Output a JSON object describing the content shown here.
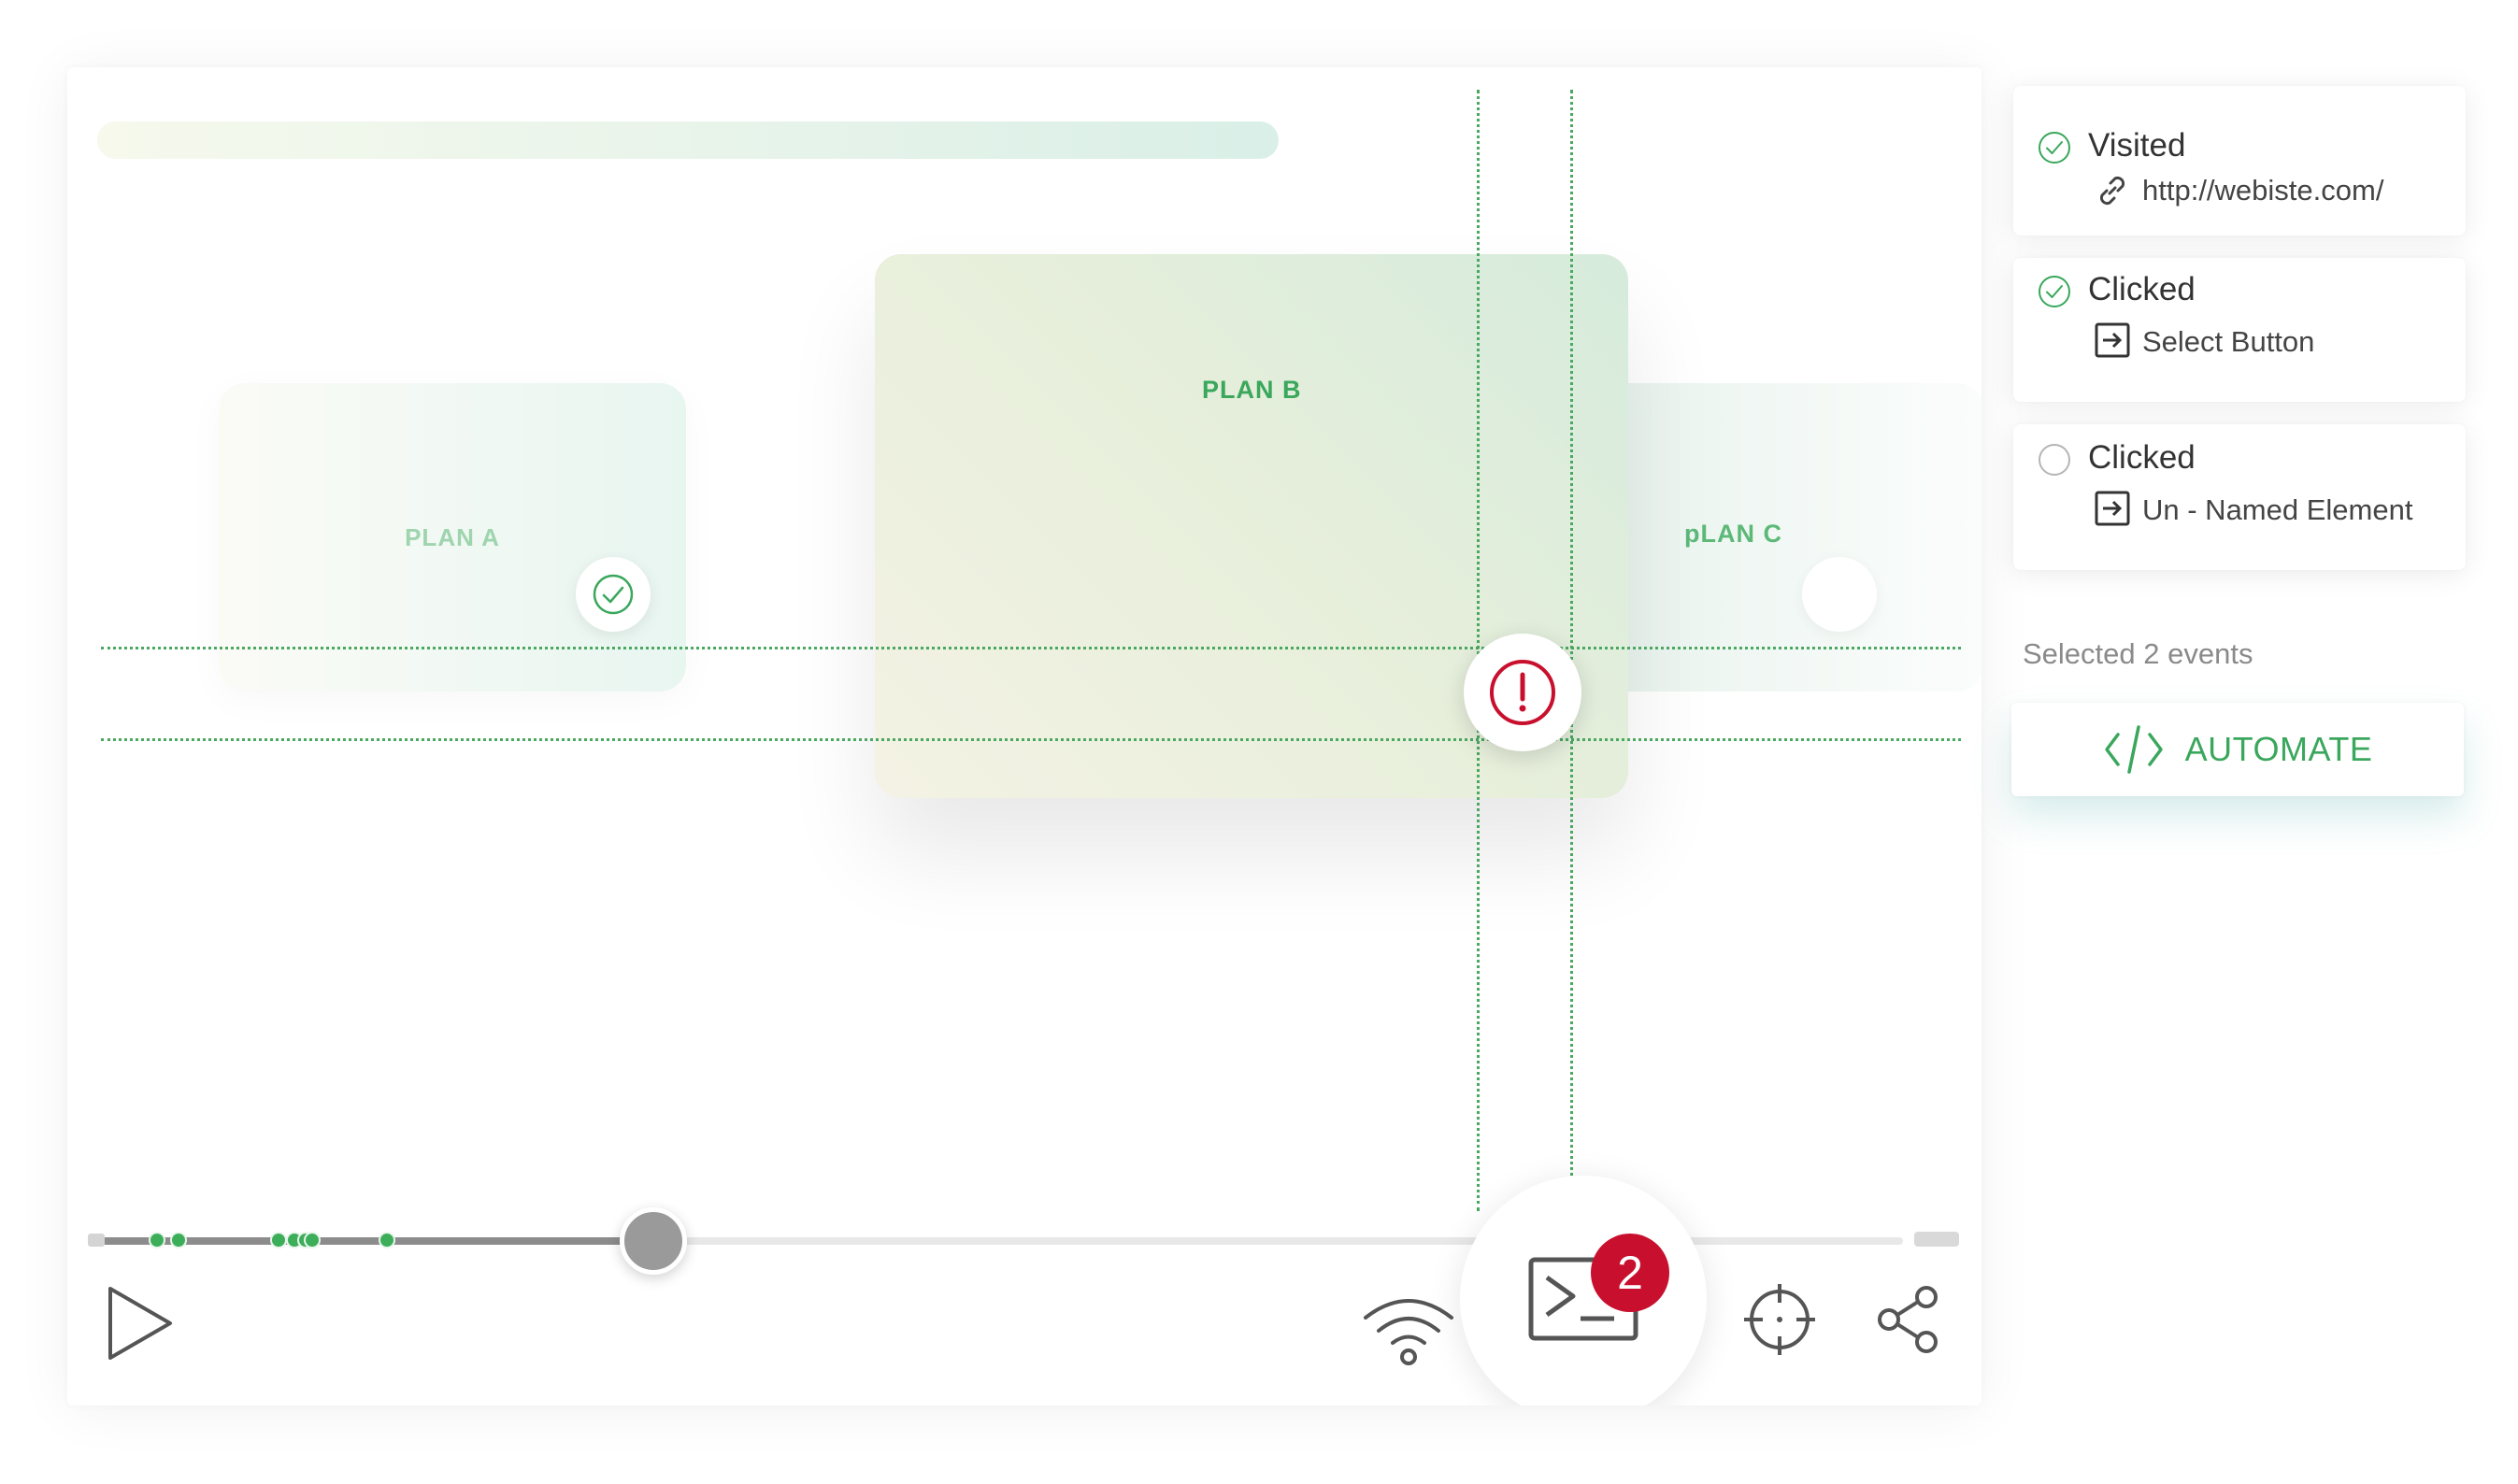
{
  "colors": {
    "accent_green": "#3aa75c",
    "alert_red": "#c8102e",
    "track_fill": "#8c8c8c",
    "marker_green": "#3cae5a"
  },
  "plans": {
    "plan_a": "PLAN A",
    "plan_b": "PLAN B",
    "plan_c": "pLAN C"
  },
  "timeline": {
    "progress": 0.31,
    "event_markers": [
      0.036,
      0.048,
      0.103,
      0.112,
      0.118,
      0.122,
      0.163
    ]
  },
  "controls": {
    "play_icon": "play-icon",
    "wifi_icon": "wifi-icon",
    "terminal_icon": "terminal-icon",
    "target_icon": "crosshair-icon",
    "share_icon": "share-icon",
    "terminal_badge_count": "2"
  },
  "events": [
    {
      "status": "done",
      "title": "Visited",
      "detail_icon": "link-icon",
      "detail": "http://webiste.com/"
    },
    {
      "status": "done",
      "title": "Clicked",
      "detail_icon": "enter-arrow-icon",
      "detail": "Select Button"
    },
    {
      "status": "pending",
      "title": "Clicked",
      "detail_icon": "enter-arrow-icon",
      "detail": "Un - Named Element"
    }
  ],
  "selection": {
    "summary": "Selected 2 events",
    "automate_label": "AUTOMATE",
    "automate_icon": "code-icon"
  }
}
